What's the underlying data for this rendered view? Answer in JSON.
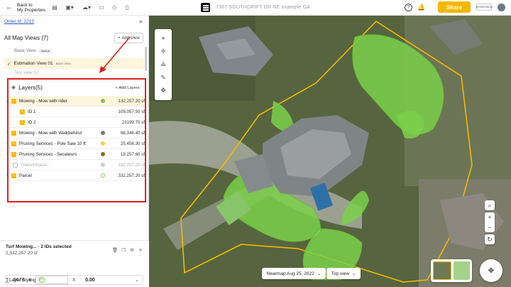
{
  "topbar": {
    "back_label_line1": "Back to",
    "back_label_line2": "My Properties",
    "title_text": "7367 SOUTHDRIFT DR NE example GA",
    "share_label": "Share",
    "brand_text": "ATTENTIVE.AI"
  },
  "left": {
    "order_id": "Order Id: 2215",
    "views_title": "All Map Views (7)",
    "add_view_label": "Add View",
    "base_view_label": "Base View",
    "base_view_badge": "default",
    "estimation_view_label": "Estimation View 01",
    "estimation_view_note": "Base View",
    "hidden_row_label": "Test View 02",
    "layers_title": "Layers(5)",
    "add_layers_label": "Add Layers",
    "layers": [
      {
        "name": "Mowing - Mow with rider",
        "area": "132,257.20 sf",
        "color": "#8bc34a",
        "checked": "partial",
        "selected": true,
        "expandable": true
      },
      {
        "name": "ID 1",
        "area": "109,057.50 sf",
        "color": "",
        "checked": "true",
        "child": true
      },
      {
        "name": "ID 2",
        "area": "23199.70 sf",
        "color": "",
        "checked": "true",
        "child": true
      },
      {
        "name": "Mowing - Mow with Walkbehind",
        "area": "68,348.40 sf",
        "color": "#7a7a7a",
        "checked": "true",
        "expandable": true
      },
      {
        "name": "Pruning Services - Pole Saw 10 ft",
        "area": "25,456.30 sf",
        "color": "#f2d24b",
        "checked": "true",
        "expandable": true
      },
      {
        "name": "Pruning Services - Secateurs",
        "area": "19,257.60 sf",
        "color": "#8a6a20",
        "checked": "true",
        "expandable": true
      },
      {
        "name": "Trees/Unassi...",
        "area": "332,257.20 sf",
        "color": "#cfcfcf",
        "checked": "false",
        "dim": true
      },
      {
        "name": "Parcel",
        "area": "332,257.20 sf",
        "color": "ring",
        "checked": "true",
        "expandable": true
      }
    ],
    "selection_title": "Turf Mowing... - 2 IDs selected",
    "selection_area": "2,332,257.20 sf",
    "layer_styling_label": "Layer Styling",
    "calc_symbol": "∑",
    "calc_count": "5678",
    "calc_operator": "x",
    "calc_input_placeholder": "0",
    "calc_equals": "=",
    "calc_result": "0.00"
  },
  "map": {
    "date_label": "Nearmap Aug 25, 2022",
    "view_label": "Top view",
    "colors": {
      "parcel": "#f5b800",
      "mow_fill": "#7ad04a",
      "accent": "#f5b800",
      "arrow": "#e02020"
    }
  }
}
